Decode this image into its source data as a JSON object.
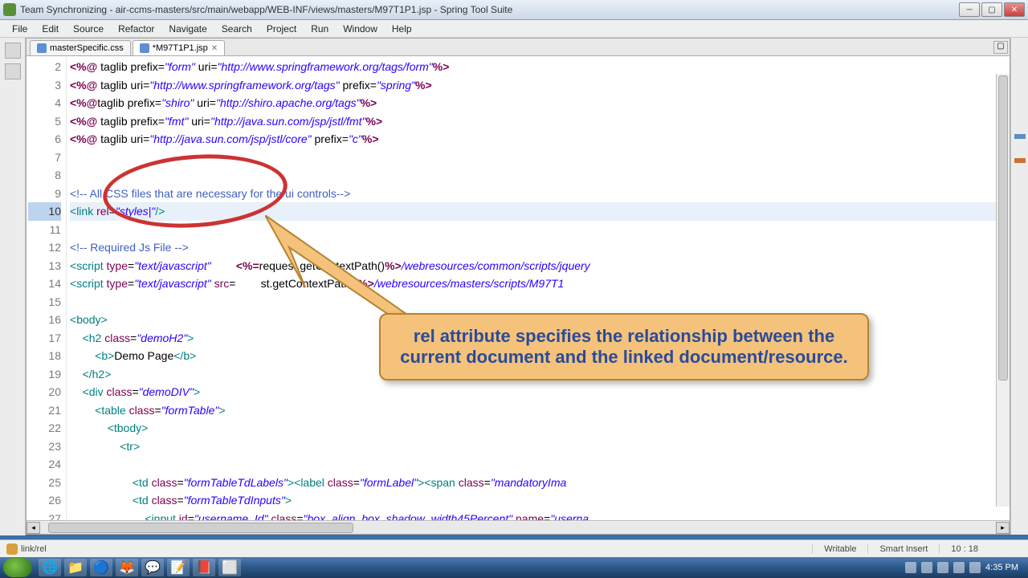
{
  "window": {
    "title": "Team Synchronizing - air-ccms-masters/src/main/webapp/WEB-INF/views/masters/M97T1P1.jsp - Spring Tool Suite"
  },
  "menu": [
    "File",
    "Edit",
    "Source",
    "Refactor",
    "Navigate",
    "Search",
    "Project",
    "Run",
    "Window",
    "Help"
  ],
  "tabs": [
    {
      "label": "masterSpecific.css",
      "dirty": false,
      "active": false
    },
    {
      "label": "*M97T1P1.jsp",
      "dirty": true,
      "active": true
    }
  ],
  "gutter_start": 2,
  "gutter_end": 27,
  "highlight_line": 10,
  "status": {
    "path": "link/rel",
    "writable": "Writable",
    "mode": "Smart Insert",
    "cursor": "10 : 18"
  },
  "callout_text": "rel attribute specifies the relationship between the current document and the linked document/resource.",
  "tray": {
    "time": "4:35 PM"
  },
  "code_tokens": {
    "l2": [
      [
        "<%@ ",
        "kw"
      ],
      [
        "taglib prefix=",
        "txt"
      ],
      [
        "\"form\"",
        "str"
      ],
      [
        " uri=",
        "txt"
      ],
      [
        "\"http://www.springframework.org/tags/form\"",
        "str"
      ],
      [
        "%>",
        "kw"
      ]
    ],
    "l3": [
      [
        "<%@ ",
        "kw"
      ],
      [
        "taglib uri=",
        "txt"
      ],
      [
        "\"http://www.springframework.org/tags\"",
        "str"
      ],
      [
        " prefix=",
        "txt"
      ],
      [
        "\"spring\"",
        "str"
      ],
      [
        "%>",
        "kw"
      ]
    ],
    "l4": [
      [
        "<%@",
        "kw"
      ],
      [
        "taglib prefix=",
        "txt"
      ],
      [
        "\"shiro\"",
        "str"
      ],
      [
        " uri=",
        "txt"
      ],
      [
        "\"http://shiro.apache.org/tags\"",
        "str"
      ],
      [
        "%>",
        "kw"
      ]
    ],
    "l5": [
      [
        "<%@ ",
        "kw"
      ],
      [
        "taglib prefix=",
        "txt"
      ],
      [
        "\"fmt\"",
        "str"
      ],
      [
        " uri=",
        "txt"
      ],
      [
        "\"http://java.sun.com/jsp/jstl/fmt\"",
        "str"
      ],
      [
        "%>",
        "kw"
      ]
    ],
    "l6": [
      [
        "<%@ ",
        "kw"
      ],
      [
        "taglib uri=",
        "txt"
      ],
      [
        "\"http://java.sun.com/jsp/jstl/core\"",
        "str"
      ],
      [
        " prefix=",
        "txt"
      ],
      [
        "\"c\"",
        "str"
      ],
      [
        "%>",
        "kw"
      ]
    ],
    "l7": [
      [
        "",
        "txt"
      ]
    ],
    "l8": [
      [
        "",
        "txt"
      ]
    ],
    "l9": [
      [
        "<!-- All CSS files that are necessary for the ui controls-->",
        "cmt"
      ]
    ],
    "l10": [
      [
        "<",
        "tag-p"
      ],
      [
        "link",
        "tag-p"
      ],
      [
        " ",
        "txt"
      ],
      [
        "rel",
        "attr"
      ],
      [
        "=",
        "txt"
      ],
      [
        "\"styles|\"",
        "str"
      ],
      [
        "/>",
        "tag-p"
      ]
    ],
    "l11": [
      [
        "",
        "txt"
      ]
    ],
    "l12": [
      [
        "<!-- Required Js File -->",
        "cmt"
      ]
    ],
    "l13": [
      [
        "<",
        "tag-p"
      ],
      [
        "script",
        "tag-p"
      ],
      [
        " ",
        "txt"
      ],
      [
        "type",
        "attr"
      ],
      [
        "=",
        "txt"
      ],
      [
        "\"text/javascript\"",
        "str"
      ],
      [
        "        ",
        "txt"
      ],
      [
        "<%=",
        "kw"
      ],
      [
        "request.getContextPath()",
        "txt"
      ],
      [
        "%>",
        "kw"
      ],
      [
        "/webresources/common/scripts/jquery",
        "str"
      ]
    ],
    "l14": [
      [
        "<",
        "tag-p"
      ],
      [
        "script",
        "tag-p"
      ],
      [
        " ",
        "txt"
      ],
      [
        "type",
        "attr"
      ],
      [
        "=",
        "txt"
      ],
      [
        "\"text/javascript\"",
        "str"
      ],
      [
        " ",
        "txt"
      ],
      [
        "src",
        "attr"
      ],
      [
        "=        ",
        "txt"
      ],
      [
        "st.getContextPath()",
        "txt"
      ],
      [
        "%>",
        "kw"
      ],
      [
        "/webresources/masters/scripts/M97T1",
        "str"
      ]
    ],
    "l15": [
      [
        "",
        "txt"
      ]
    ],
    "l16": [
      [
        "<",
        "tag-p"
      ],
      [
        "body",
        "tag-p"
      ],
      [
        ">",
        "tag-p"
      ]
    ],
    "l17": [
      [
        "    ",
        "txt"
      ],
      [
        "<",
        "tag-p"
      ],
      [
        "h2",
        "tag-p"
      ],
      [
        " ",
        "txt"
      ],
      [
        "class",
        "attr"
      ],
      [
        "=",
        "txt"
      ],
      [
        "\"demoH2\"",
        "str"
      ],
      [
        ">",
        "tag-p"
      ]
    ],
    "l18": [
      [
        "        ",
        "txt"
      ],
      [
        "<",
        "tag-p"
      ],
      [
        "b",
        "tag-p"
      ],
      [
        ">",
        "tag-p"
      ],
      [
        "Demo Page",
        "txt"
      ],
      [
        "</",
        "tag-p"
      ],
      [
        "b",
        "tag-p"
      ],
      [
        ">",
        "tag-p"
      ]
    ],
    "l19": [
      [
        "    ",
        "txt"
      ],
      [
        "</",
        "tag-p"
      ],
      [
        "h2",
        "tag-p"
      ],
      [
        ">",
        "tag-p"
      ]
    ],
    "l20": [
      [
        "    ",
        "txt"
      ],
      [
        "<",
        "tag-p"
      ],
      [
        "div",
        "tag-p"
      ],
      [
        " ",
        "txt"
      ],
      [
        "class",
        "attr"
      ],
      [
        "=",
        "txt"
      ],
      [
        "\"demoDIV\"",
        "str"
      ],
      [
        ">",
        "tag-p"
      ]
    ],
    "l21": [
      [
        "        ",
        "txt"
      ],
      [
        "<",
        "tag-p"
      ],
      [
        "table",
        "tag-p"
      ],
      [
        " ",
        "txt"
      ],
      [
        "class",
        "attr"
      ],
      [
        "=",
        "txt"
      ],
      [
        "\"formTable\"",
        "str"
      ],
      [
        ">",
        "tag-p"
      ]
    ],
    "l22": [
      [
        "            ",
        "txt"
      ],
      [
        "<",
        "tag-p"
      ],
      [
        "tbody",
        "tag-p"
      ],
      [
        ">",
        "tag-p"
      ]
    ],
    "l23": [
      [
        "                ",
        "txt"
      ],
      [
        "<",
        "tag-p"
      ],
      [
        "tr",
        "tag-p"
      ],
      [
        ">",
        "tag-p"
      ]
    ],
    "l24": [
      [
        "",
        "txt"
      ]
    ],
    "l25": [
      [
        "                    ",
        "txt"
      ],
      [
        "<",
        "tag-p"
      ],
      [
        "td",
        "tag-p"
      ],
      [
        " ",
        "txt"
      ],
      [
        "class",
        "attr"
      ],
      [
        "=",
        "txt"
      ],
      [
        "\"formTableTdLabels\"",
        "str"
      ],
      [
        ">",
        "tag-p"
      ],
      [
        "<",
        "tag-p"
      ],
      [
        "label",
        "tag-p"
      ],
      [
        " ",
        "txt"
      ],
      [
        "class",
        "attr"
      ],
      [
        "=",
        "txt"
      ],
      [
        "\"formLabel\"",
        "str"
      ],
      [
        ">",
        "tag-p"
      ],
      [
        "<",
        "tag-p"
      ],
      [
        "span",
        "tag-p"
      ],
      [
        " ",
        "txt"
      ],
      [
        "class",
        "attr"
      ],
      [
        "=",
        "txt"
      ],
      [
        "\"mandatoryIma",
        "str"
      ]
    ],
    "l26": [
      [
        "                    ",
        "txt"
      ],
      [
        "<",
        "tag-p"
      ],
      [
        "td",
        "tag-p"
      ],
      [
        " ",
        "txt"
      ],
      [
        "class",
        "attr"
      ],
      [
        "=",
        "txt"
      ],
      [
        "\"formTableTdInputs\"",
        "str"
      ],
      [
        ">",
        "tag-p"
      ]
    ],
    "l27": [
      [
        "                        ",
        "txt"
      ],
      [
        "<",
        "tag-p"
      ],
      [
        "input",
        "tag-p"
      ],
      [
        " ",
        "txt"
      ],
      [
        "id",
        "attr"
      ],
      [
        "=",
        "txt"
      ],
      [
        "\"username_Id\"",
        "str"
      ],
      [
        " ",
        "txt"
      ],
      [
        "class",
        "attr"
      ],
      [
        "=",
        "txt"
      ],
      [
        "\"box_align_box_shadow_width45Percent\"",
        "str"
      ],
      [
        " ",
        "txt"
      ],
      [
        "name",
        "attr"
      ],
      [
        "=",
        "txt"
      ],
      [
        "\"userna",
        "str"
      ]
    ]
  }
}
